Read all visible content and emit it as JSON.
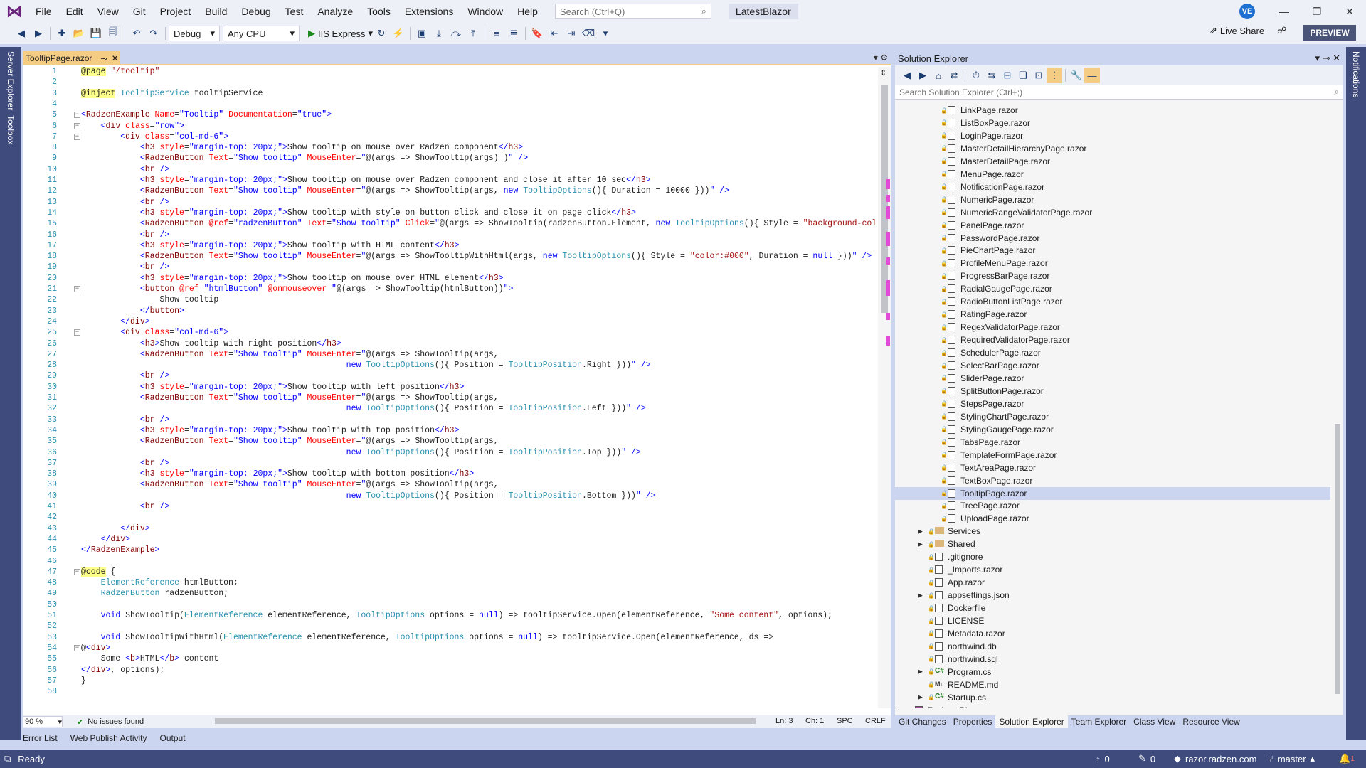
{
  "menubar": {
    "items": [
      "File",
      "Edit",
      "View",
      "Git",
      "Project",
      "Build",
      "Debug",
      "Test",
      "Analyze",
      "Tools",
      "Extensions",
      "Window",
      "Help"
    ],
    "search_placeholder": "Search (Ctrl+Q)",
    "solution_name": "LatestBlazor",
    "user_initials": "VE"
  },
  "toolbar": {
    "config": "Debug",
    "platform": "Any CPU",
    "run_target": "IIS Express",
    "live_share": "Live Share",
    "preview": "PREVIEW"
  },
  "sidebars": {
    "left": [
      "Server Explorer",
      "Toolbox"
    ],
    "right": "Notifications"
  },
  "editor": {
    "tab_name": "TooltipPage.razor",
    "zoom": "90 %",
    "issues": "No issues found",
    "line": "Ln: 3",
    "col": "Ch: 1",
    "spacing": "SPC",
    "eol": "CRLF",
    "lines": [
      {
        "n": "1",
        "html": "<span class='d'>@page</span> <span class='sl'>\"/tooltip\"</span>"
      },
      {
        "n": "2",
        "html": ""
      },
      {
        "n": "3",
        "html": "<span class='d'>@inject</span> <span class='ty'>TooltipService</span> tooltipService"
      },
      {
        "n": "4",
        "html": ""
      },
      {
        "n": "5",
        "html": "<span class='s'>&lt;</span><span class='t'>RadzenExample</span> <span class='a'>Name</span>=<span class='s'>\"Tooltip\"</span> <span class='a'>Documentation</span>=<span class='s'>\"true\"</span><span class='s'>&gt;</span>"
      },
      {
        "n": "6",
        "html": "    <span class='s'>&lt;</span><span class='t'>div</span> <span class='a'>class</span>=<span class='s'>\"row\"</span><span class='s'>&gt;</span>"
      },
      {
        "n": "7",
        "html": "        <span class='s'>&lt;</span><span class='t'>div</span> <span class='a'>class</span>=<span class='s'>\"col-md-6\"</span><span class='s'>&gt;</span>"
      },
      {
        "n": "8",
        "html": "            <span class='s'>&lt;</span><span class='t'>h3</span> <span class='a'>style</span>=<span class='s'>\"margin-top: 20px;\"</span><span class='s'>&gt;</span>Show tooltip on mouse over Radzen component<span class='s'>&lt;/</span><span class='t'>h3</span><span class='s'>&gt;</span>"
      },
      {
        "n": "9",
        "html": "            <span class='s'>&lt;</span><span class='t'>RadzenButton</span> <span class='a'>Text</span>=<span class='s'>\"Show tooltip\"</span> <span class='a'>MouseEnter</span>=<span class='s'>\"</span>@(args =&gt; ShowTooltip(args) )<span class='s'>\"</span> <span class='s'>/&gt;</span>"
      },
      {
        "n": "10",
        "html": "            <span class='s'>&lt;</span><span class='t'>br</span> <span class='s'>/&gt;</span>"
      },
      {
        "n": "11",
        "html": "            <span class='s'>&lt;</span><span class='t'>h3</span> <span class='a'>style</span>=<span class='s'>\"margin-top: 20px;\"</span><span class='s'>&gt;</span>Show tooltip on mouse over Radzen component and close it after 10 sec<span class='s'>&lt;/</span><span class='t'>h3</span><span class='s'>&gt;</span>"
      },
      {
        "n": "12",
        "html": "            <span class='s'>&lt;</span><span class='t'>RadzenButton</span> <span class='a'>Text</span>=<span class='s'>\"Show tooltip\"</span> <span class='a'>MouseEnter</span>=<span class='s'>\"</span>@(args =&gt; ShowTooltip(args, <span class='k'>new</span> <span class='ty'>TooltipOptions</span>(){ Duration = 10000 }))<span class='s'>\"</span> <span class='s'>/&gt;</span>"
      },
      {
        "n": "13",
        "html": "            <span class='s'>&lt;</span><span class='t'>br</span> <span class='s'>/&gt;</span>"
      },
      {
        "n": "14",
        "html": "            <span class='s'>&lt;</span><span class='t'>h3</span> <span class='a'>style</span>=<span class='s'>\"margin-top: 20px;\"</span><span class='s'>&gt;</span>Show tooltip with style on button click and close it on page click<span class='s'>&lt;/</span><span class='t'>h3</span><span class='s'>&gt;</span>"
      },
      {
        "n": "15",
        "html": "            <span class='s'>&lt;</span><span class='t'>RadzenButton</span> <span class='a'>@ref</span>=<span class='s'>\"radzenButton\"</span> <span class='a'>Text</span>=<span class='s'>\"Show tooltip\"</span> <span class='a'>Click</span>=<span class='s'>\"</span>@(args =&gt; ShowTooltip(radzenButton.Element, <span class='k'>new</span> <span class='ty'>TooltipOptions</span>(){ Style = <span class='sl'>\"background-color: #ffffca;</span>"
      },
      {
        "n": "16",
        "html": "            <span class='s'>&lt;</span><span class='t'>br</span> <span class='s'>/&gt;</span>"
      },
      {
        "n": "17",
        "html": "            <span class='s'>&lt;</span><span class='t'>h3</span> <span class='a'>style</span>=<span class='s'>\"margin-top: 20px;\"</span><span class='s'>&gt;</span>Show tooltip with HTML content<span class='s'>&lt;/</span><span class='t'>h3</span><span class='s'>&gt;</span>"
      },
      {
        "n": "18",
        "html": "            <span class='s'>&lt;</span><span class='t'>RadzenButton</span> <span class='a'>Text</span>=<span class='s'>\"Show tooltip\"</span> <span class='a'>MouseEnter</span>=<span class='s'>\"</span>@(args =&gt; ShowTooltipWithHtml(args, <span class='k'>new</span> <span class='ty'>TooltipOptions</span>(){ Style = <span class='sl'>\"color:#000\"</span>, Duration = <span class='k'>null</span> }))<span class='s'>\"</span> <span class='s'>/&gt;</span>"
      },
      {
        "n": "19",
        "html": "            <span class='s'>&lt;</span><span class='t'>br</span> <span class='s'>/&gt;</span>"
      },
      {
        "n": "20",
        "html": "            <span class='s'>&lt;</span><span class='t'>h3</span> <span class='a'>style</span>=<span class='s'>\"margin-top: 20px;\"</span><span class='s'>&gt;</span>Show tooltip on mouse over HTML element<span class='s'>&lt;/</span><span class='t'>h3</span><span class='s'>&gt;</span>"
      },
      {
        "n": "21",
        "html": "            <span class='s'>&lt;</span><span class='t'>button</span> <span class='a'>@ref</span>=<span class='s'>\"htmlButton\"</span> <span class='a'>@onmouseover</span>=<span class='s'>\"</span>@(args =&gt; ShowTooltip(htmlButton))<span class='s'>\"</span><span class='s'>&gt;</span>"
      },
      {
        "n": "22",
        "html": "                Show tooltip"
      },
      {
        "n": "23",
        "html": "            <span class='s'>&lt;/</span><span class='t'>button</span><span class='s'>&gt;</span>"
      },
      {
        "n": "24",
        "html": "        <span class='s'>&lt;/</span><span class='t'>div</span><span class='s'>&gt;</span>"
      },
      {
        "n": "25",
        "html": "        <span class='s'>&lt;</span><span class='t'>div</span> <span class='a'>class</span>=<span class='s'>\"col-md-6\"</span><span class='s'>&gt;</span>"
      },
      {
        "n": "26",
        "html": "            <span class='s'>&lt;</span><span class='t'>h3</span><span class='s'>&gt;</span>Show tooltip with right position<span class='s'>&lt;/</span><span class='t'>h3</span><span class='s'>&gt;</span>"
      },
      {
        "n": "27",
        "html": "            <span class='s'>&lt;</span><span class='t'>RadzenButton</span> <span class='a'>Text</span>=<span class='s'>\"Show tooltip\"</span> <span class='a'>MouseEnter</span>=<span class='s'>\"</span>@(args =&gt; ShowTooltip(args,"
      },
      {
        "n": "28",
        "html": "                                                      <span class='k'>new</span> <span class='ty'>TooltipOptions</span>(){ Position = <span class='ty'>TooltipPosition</span>.Right }))<span class='s'>\"</span> <span class='s'>/&gt;</span>"
      },
      {
        "n": "29",
        "html": "            <span class='s'>&lt;</span><span class='t'>br</span> <span class='s'>/&gt;</span>"
      },
      {
        "n": "30",
        "html": "            <span class='s'>&lt;</span><span class='t'>h3</span> <span class='a'>style</span>=<span class='s'>\"margin-top: 20px;\"</span><span class='s'>&gt;</span>Show tooltip with left position<span class='s'>&lt;/</span><span class='t'>h3</span><span class='s'>&gt;</span>"
      },
      {
        "n": "31",
        "html": "            <span class='s'>&lt;</span><span class='t'>RadzenButton</span> <span class='a'>Text</span>=<span class='s'>\"Show tooltip\"</span> <span class='a'>MouseEnter</span>=<span class='s'>\"</span>@(args =&gt; ShowTooltip(args,"
      },
      {
        "n": "32",
        "html": "                                                      <span class='k'>new</span> <span class='ty'>TooltipOptions</span>(){ Position = <span class='ty'>TooltipPosition</span>.Left }))<span class='s'>\"</span> <span class='s'>/&gt;</span>"
      },
      {
        "n": "33",
        "html": "            <span class='s'>&lt;</span><span class='t'>br</span> <span class='s'>/&gt;</span>"
      },
      {
        "n": "34",
        "html": "            <span class='s'>&lt;</span><span class='t'>h3</span> <span class='a'>style</span>=<span class='s'>\"margin-top: 20px;\"</span><span class='s'>&gt;</span>Show tooltip with top position<span class='s'>&lt;/</span><span class='t'>h3</span><span class='s'>&gt;</span>"
      },
      {
        "n": "35",
        "html": "            <span class='s'>&lt;</span><span class='t'>RadzenButton</span> <span class='a'>Text</span>=<span class='s'>\"Show tooltip\"</span> <span class='a'>MouseEnter</span>=<span class='s'>\"</span>@(args =&gt; ShowTooltip(args,"
      },
      {
        "n": "36",
        "html": "                                                      <span class='k'>new</span> <span class='ty'>TooltipOptions</span>(){ Position = <span class='ty'>TooltipPosition</span>.Top }))<span class='s'>\"</span> <span class='s'>/&gt;</span>"
      },
      {
        "n": "37",
        "html": "            <span class='s'>&lt;</span><span class='t'>br</span> <span class='s'>/&gt;</span>"
      },
      {
        "n": "38",
        "html": "            <span class='s'>&lt;</span><span class='t'>h3</span> <span class='a'>style</span>=<span class='s'>\"margin-top: 20px;\"</span><span class='s'>&gt;</span>Show tooltip with bottom position<span class='s'>&lt;/</span><span class='t'>h3</span><span class='s'>&gt;</span>"
      },
      {
        "n": "39",
        "html": "            <span class='s'>&lt;</span><span class='t'>RadzenButton</span> <span class='a'>Text</span>=<span class='s'>\"Show tooltip\"</span> <span class='a'>MouseEnter</span>=<span class='s'>\"</span>@(args =&gt; ShowTooltip(args,"
      },
      {
        "n": "40",
        "html": "                                                      <span class='k'>new</span> <span class='ty'>TooltipOptions</span>(){ Position = <span class='ty'>TooltipPosition</span>.Bottom }))<span class='s'>\"</span> <span class='s'>/&gt;</span>"
      },
      {
        "n": "41",
        "html": "            <span class='s'>&lt;</span><span class='t'>br</span> <span class='s'>/&gt;</span>"
      },
      {
        "n": "42",
        "html": ""
      },
      {
        "n": "43",
        "html": "        <span class='s'>&lt;/</span><span class='t'>div</span><span class='s'>&gt;</span>"
      },
      {
        "n": "44",
        "html": "    <span class='s'>&lt;/</span><span class='t'>div</span><span class='s'>&gt;</span>"
      },
      {
        "n": "45",
        "html": "<span class='s'>&lt;/</span><span class='t'>RadzenExample</span><span class='s'>&gt;</span>"
      },
      {
        "n": "46",
        "html": ""
      },
      {
        "n": "47",
        "html": "<span class='d'>@code</span> {"
      },
      {
        "n": "48",
        "html": "    <span class='ty'>ElementReference</span> htmlButton;"
      },
      {
        "n": "49",
        "html": "    <span class='ty'>RadzenButton</span> radzenButton;"
      },
      {
        "n": "50",
        "html": ""
      },
      {
        "n": "51",
        "html": "    <span class='k'>void</span> ShowTooltip(<span class='ty'>ElementReference</span> elementReference, <span class='ty'>TooltipOptions</span> options = <span class='k'>null</span>) =&gt; tooltipService.Open(elementReference, <span class='sl'>\"Some content\"</span>, options);"
      },
      {
        "n": "52",
        "html": ""
      },
      {
        "n": "53",
        "html": "    <span class='k'>void</span> ShowTooltipWithHtml(<span class='ty'>ElementReference</span> elementReference, <span class='ty'>TooltipOptions</span> options = <span class='k'>null</span>) =&gt; tooltipService.Open(elementReference, ds =&gt;"
      },
      {
        "n": "54",
        "html": "@<span class='s'>&lt;</span><span class='t'>div</span><span class='s'>&gt;</span>"
      },
      {
        "n": "55",
        "html": "    Some <span class='s'>&lt;</span><span class='t'>b</span><span class='s'>&gt;</span>HTML<span class='s'>&lt;/</span><span class='t'>b</span><span class='s'>&gt;</span> content"
      },
      {
        "n": "56",
        "html": "<span class='s'>&lt;/</span><span class='t'>div</span><span class='s'>&gt;</span>, options);"
      },
      {
        "n": "57",
        "html": "}"
      },
      {
        "n": "58",
        "html": ""
      }
    ]
  },
  "solution_explorer": {
    "title": "Solution Explorer",
    "search_placeholder": "Search Solution Explorer (Ctrl+;)",
    "items": [
      {
        "label": "LinkPage.razor",
        "kind": "file",
        "indent": 3
      },
      {
        "label": "ListBoxPage.razor",
        "kind": "file",
        "indent": 3
      },
      {
        "label": "LoginPage.razor",
        "kind": "file",
        "indent": 3
      },
      {
        "label": "MasterDetailHierarchyPage.razor",
        "kind": "file",
        "indent": 3
      },
      {
        "label": "MasterDetailPage.razor",
        "kind": "file",
        "indent": 3
      },
      {
        "label": "MenuPage.razor",
        "kind": "file",
        "indent": 3
      },
      {
        "label": "NotificationPage.razor",
        "kind": "file",
        "indent": 3
      },
      {
        "label": "NumericPage.razor",
        "kind": "file",
        "indent": 3
      },
      {
        "label": "NumericRangeValidatorPage.razor",
        "kind": "file",
        "indent": 3
      },
      {
        "label": "PanelPage.razor",
        "kind": "file",
        "indent": 3
      },
      {
        "label": "PasswordPage.razor",
        "kind": "file",
        "indent": 3
      },
      {
        "label": "PieChartPage.razor",
        "kind": "file",
        "indent": 3
      },
      {
        "label": "ProfileMenuPage.razor",
        "kind": "file",
        "indent": 3
      },
      {
        "label": "ProgressBarPage.razor",
        "kind": "file",
        "indent": 3
      },
      {
        "label": "RadialGaugePage.razor",
        "kind": "file",
        "indent": 3
      },
      {
        "label": "RadioButtonListPage.razor",
        "kind": "file",
        "indent": 3
      },
      {
        "label": "RatingPage.razor",
        "kind": "file",
        "indent": 3
      },
      {
        "label": "RegexValidatorPage.razor",
        "kind": "file",
        "indent": 3
      },
      {
        "label": "RequiredValidatorPage.razor",
        "kind": "file",
        "indent": 3
      },
      {
        "label": "SchedulerPage.razor",
        "kind": "file",
        "indent": 3
      },
      {
        "label": "SelectBarPage.razor",
        "kind": "file",
        "indent": 3
      },
      {
        "label": "SliderPage.razor",
        "kind": "file",
        "indent": 3
      },
      {
        "label": "SplitButtonPage.razor",
        "kind": "file",
        "indent": 3
      },
      {
        "label": "StepsPage.razor",
        "kind": "file",
        "indent": 3
      },
      {
        "label": "StylingChartPage.razor",
        "kind": "file",
        "indent": 3
      },
      {
        "label": "StylingGaugePage.razor",
        "kind": "file",
        "indent": 3
      },
      {
        "label": "TabsPage.razor",
        "kind": "file",
        "indent": 3
      },
      {
        "label": "TemplateFormPage.razor",
        "kind": "file",
        "indent": 3
      },
      {
        "label": "TextAreaPage.razor",
        "kind": "file",
        "indent": 3
      },
      {
        "label": "TextBoxPage.razor",
        "kind": "file",
        "indent": 3
      },
      {
        "label": "TooltipPage.razor",
        "kind": "file",
        "indent": 3,
        "selected": true
      },
      {
        "label": "TreePage.razor",
        "kind": "file",
        "indent": 3
      },
      {
        "label": "UploadPage.razor",
        "kind": "file",
        "indent": 3
      },
      {
        "label": "Services",
        "kind": "folder",
        "indent": 2,
        "expandable": true
      },
      {
        "label": "Shared",
        "kind": "folder",
        "indent": 2,
        "expandable": true
      },
      {
        "label": ".gitignore",
        "kind": "file",
        "indent": 2
      },
      {
        "label": "_Imports.razor",
        "kind": "file",
        "indent": 2
      },
      {
        "label": "App.razor",
        "kind": "file",
        "indent": 2
      },
      {
        "label": "appsettings.json",
        "kind": "file",
        "indent": 2,
        "expandable": true
      },
      {
        "label": "Dockerfile",
        "kind": "file",
        "indent": 2
      },
      {
        "label": "LICENSE",
        "kind": "file",
        "indent": 2
      },
      {
        "label": "Metadata.razor",
        "kind": "file",
        "indent": 2
      },
      {
        "label": "northwind.db",
        "kind": "file",
        "indent": 2
      },
      {
        "label": "northwind.sql",
        "kind": "file",
        "indent": 2
      },
      {
        "label": "Program.cs",
        "kind": "cs",
        "indent": 2,
        "expandable": true
      },
      {
        "label": "README.md",
        "kind": "md",
        "indent": 2
      },
      {
        "label": "Startup.cs",
        "kind": "cs",
        "indent": 2,
        "expandable": true
      },
      {
        "label": "Radzen.Blazor",
        "kind": "project",
        "indent": 1,
        "expandable": true
      }
    ],
    "tabs": [
      "Git Changes",
      "Properties",
      "Solution Explorer",
      "Team Explorer",
      "Class View",
      "Resource View"
    ],
    "active_tab": "Solution Explorer"
  },
  "bottom_tabs": [
    "Error List",
    "Web Publish Activity",
    "Output"
  ],
  "statusbar": {
    "ready": "Ready",
    "up_count": "0",
    "edit_count": "0",
    "repo": "razor.radzen.com",
    "branch": "master",
    "notif_count": "1"
  },
  "colors": {
    "accent": "#3e4b7c",
    "tab_active": "#f5cc84",
    "keyword": "#0000ff",
    "type": "#2b91af"
  }
}
